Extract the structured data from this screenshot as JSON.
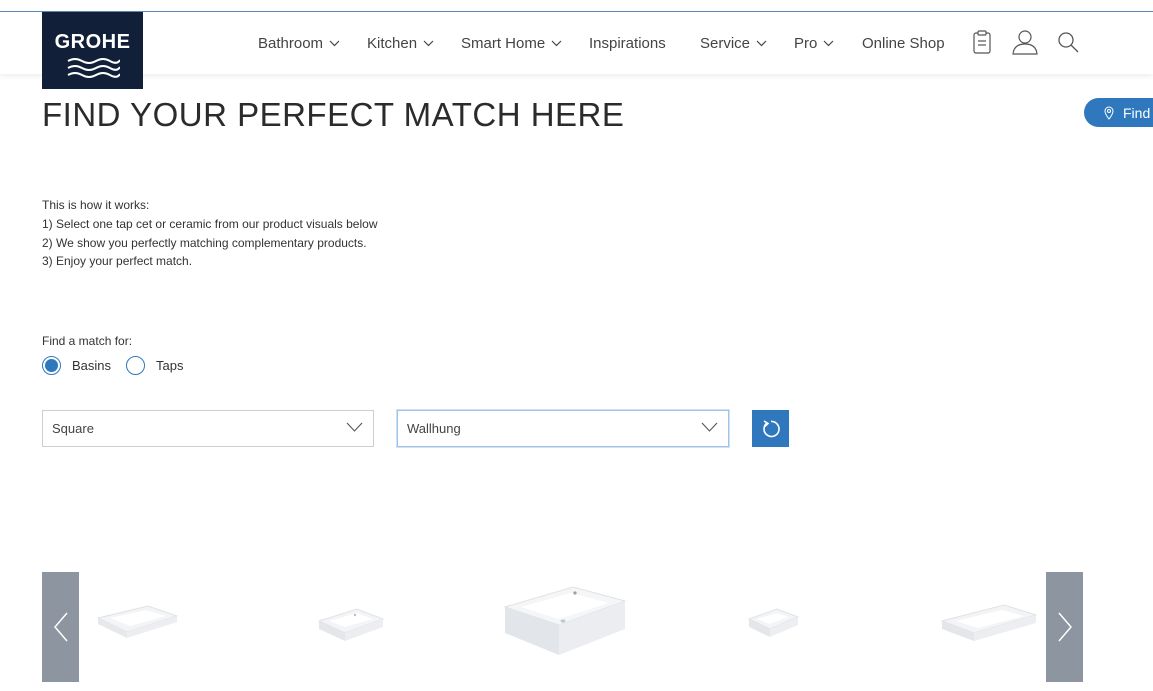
{
  "brand": {
    "name": "GROHE"
  },
  "nav": {
    "items": [
      {
        "label": "Bathroom",
        "has_dropdown": true
      },
      {
        "label": "Kitchen",
        "has_dropdown": true
      },
      {
        "label": "Smart Home",
        "has_dropdown": true
      },
      {
        "label": "Inspirations",
        "has_dropdown": false
      },
      {
        "label": "Service",
        "has_dropdown": true
      },
      {
        "label": "Pro",
        "has_dropdown": true
      },
      {
        "label": "Online Shop",
        "has_dropdown": false
      }
    ],
    "icons": [
      "clipboard-icon",
      "user-icon",
      "search-icon"
    ]
  },
  "find_button": {
    "label": "Find",
    "icon": "location-pin-icon"
  },
  "main": {
    "title": "FIND YOUR PERFECT MATCH HERE",
    "instructions": [
      "This is how it works:",
      "1) Select one tap cet or ceramic from our product visuals below",
      "2) We show you perfectly matching complementary products.",
      "3) Enjoy your perfect match."
    ],
    "match_label": "Find a match for:",
    "options": [
      {
        "label": "Basins",
        "selected": true
      },
      {
        "label": "Taps",
        "selected": false
      }
    ],
    "filters": {
      "shape": "Square",
      "mounting": "Wallhung"
    },
    "reset_icon": "reset-icon"
  },
  "carousel": {
    "prev_icon": "chevron-left-icon",
    "next_icon": "chevron-right-icon",
    "products": [
      "basin-image",
      "basin-image",
      "basin-image",
      "basin-image",
      "basin-image"
    ]
  },
  "colors": {
    "brand_navy": "#112038",
    "accent_blue": "#2f78bd",
    "arrow_grey": "#8c95a0"
  }
}
